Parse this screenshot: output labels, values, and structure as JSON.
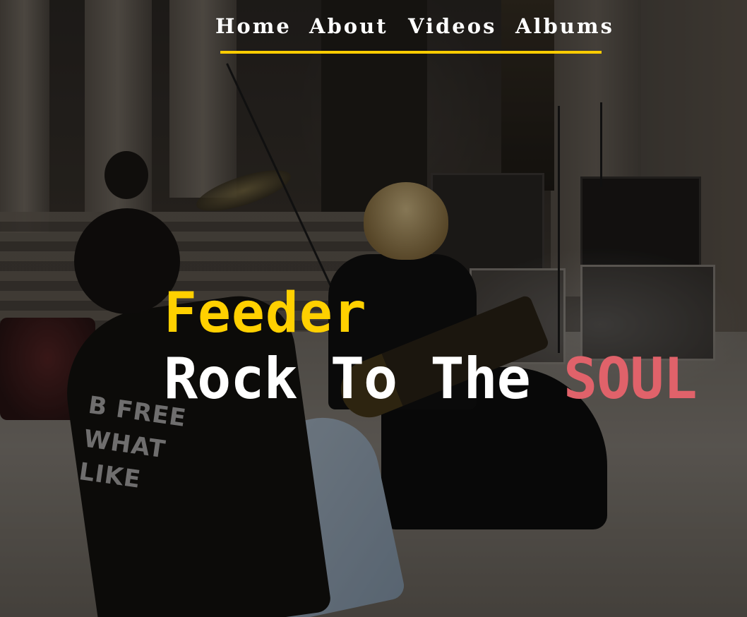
{
  "nav": {
    "items": [
      {
        "label": "Home"
      },
      {
        "label": "About"
      },
      {
        "label": "Videos"
      },
      {
        "label": "Albums"
      }
    ]
  },
  "hero": {
    "band_name": "Feeder",
    "tagline_prefix": "Rock To The",
    "tagline_accent": "SOUL",
    "shirt_text": [
      "B FREE",
      "WHAT",
      "LIKE"
    ]
  },
  "colors": {
    "accent_yellow": "#ffd000",
    "accent_red": "#e0626a",
    "nav_text": "#ffffff",
    "nav_underline": "#ffcc00"
  }
}
